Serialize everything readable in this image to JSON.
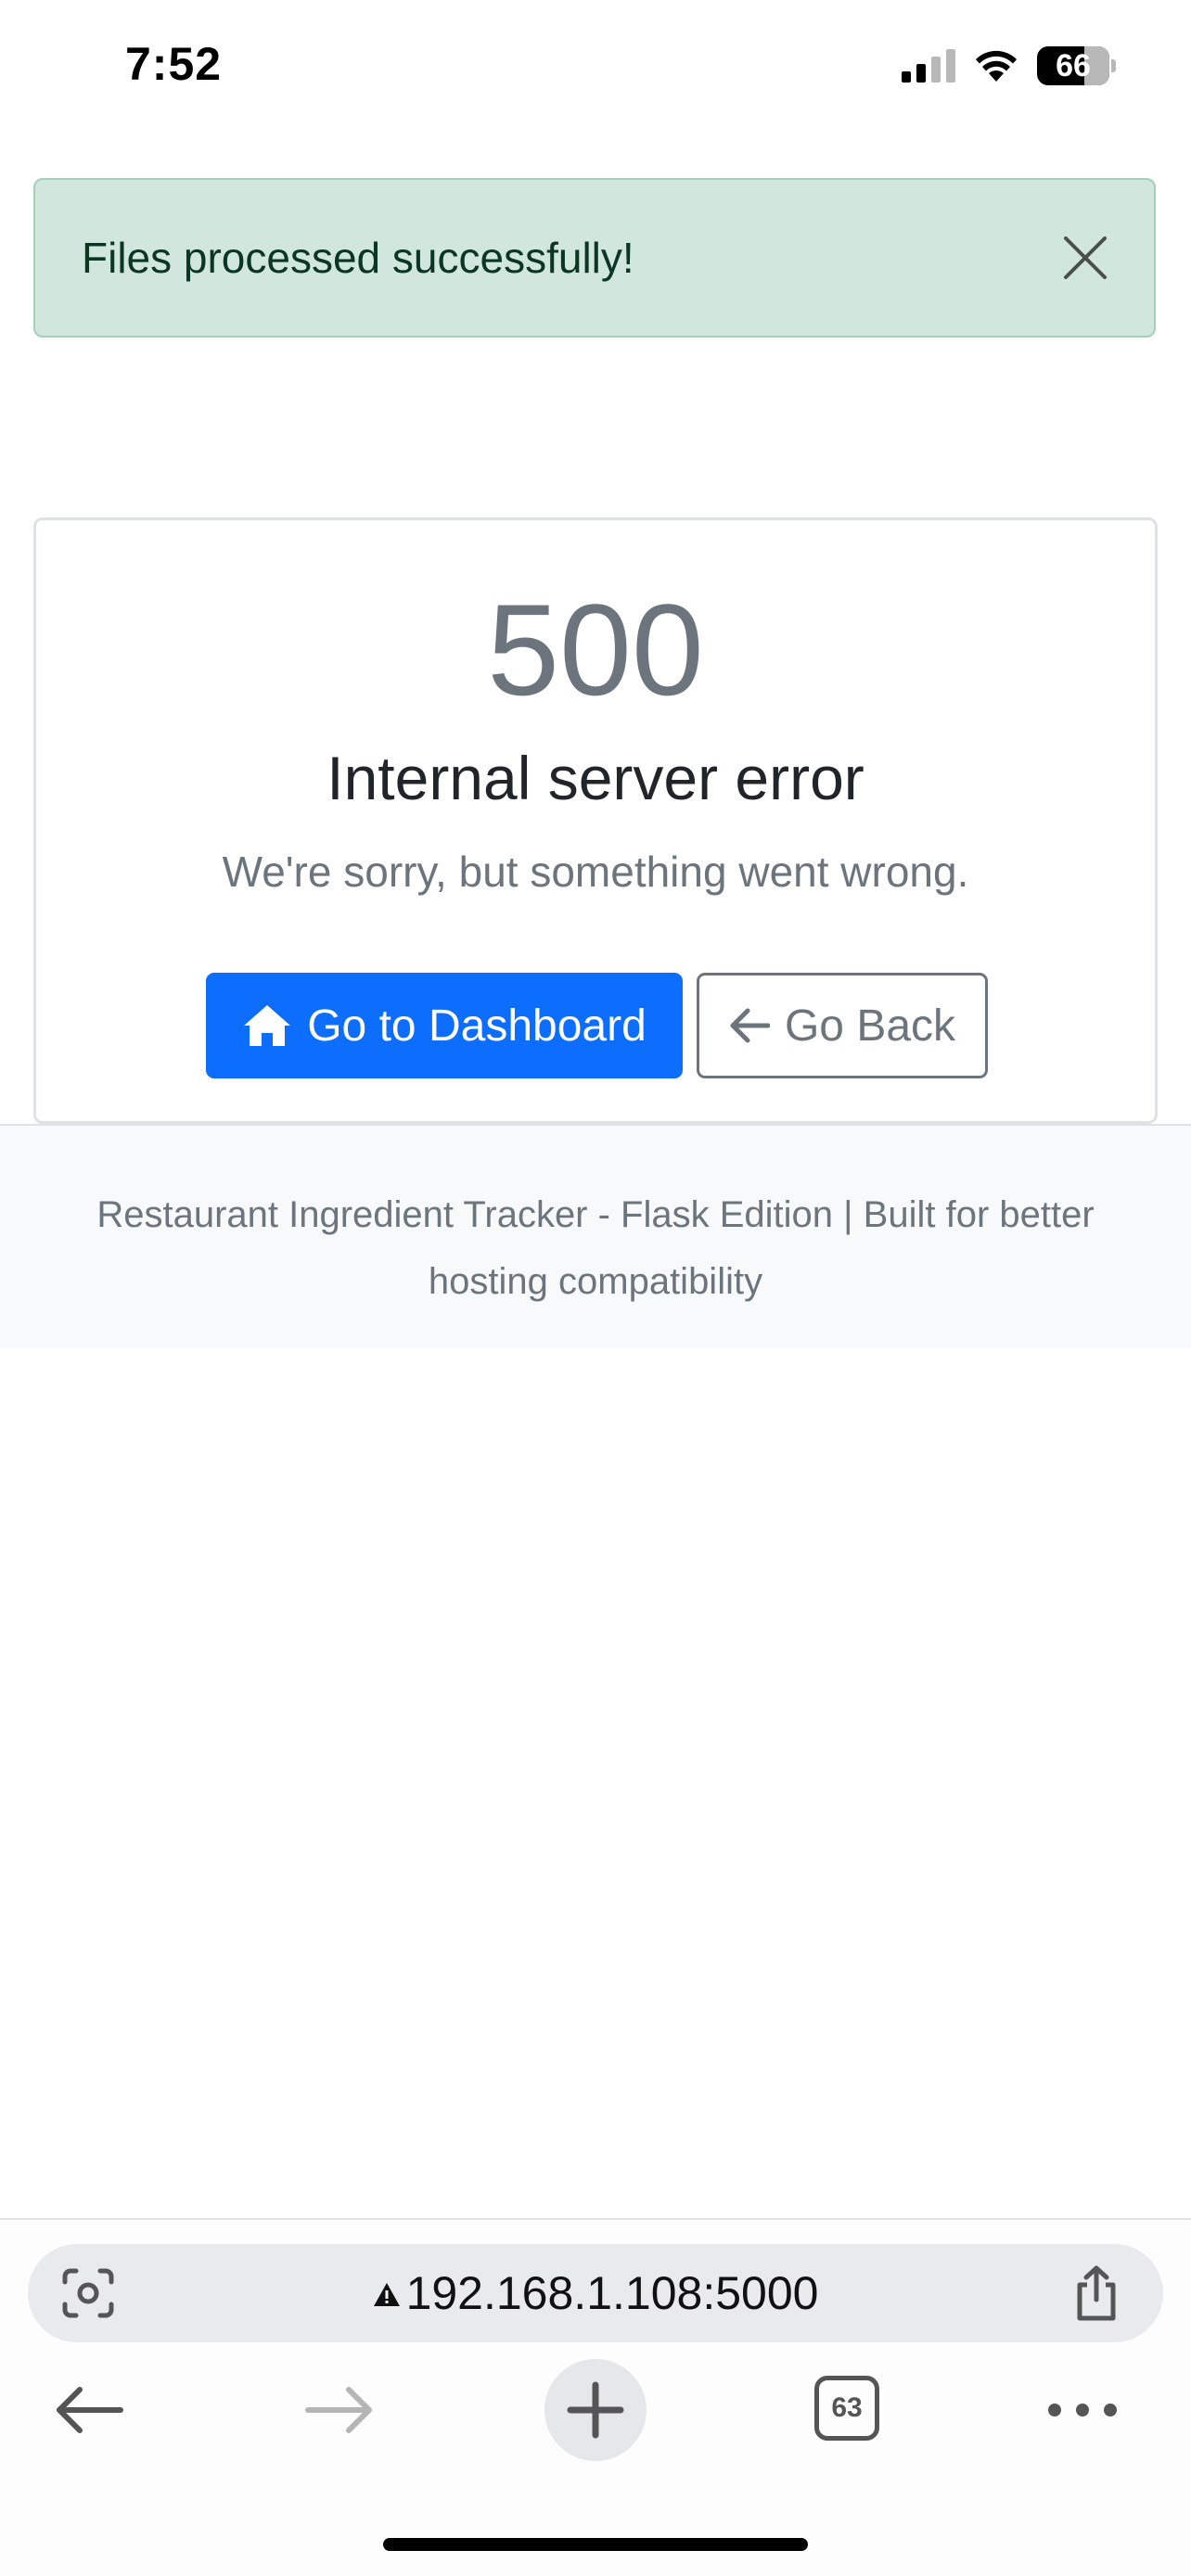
{
  "status_bar": {
    "time": "7:52",
    "battery_level": "66",
    "battery_fraction": 0.66
  },
  "alert": {
    "message": "Files processed successfully!",
    "close_icon": "close-icon",
    "colors": {
      "background": "#d1e7dd",
      "border": "#a3cfbb",
      "text": "#0a3622"
    }
  },
  "error_card": {
    "code": "500",
    "title": "Internal server error",
    "message": "We're sorry, but something went wrong.",
    "primary_button": {
      "label": "Go to Dashboard",
      "icon": "home-icon",
      "color": "#0d6efd"
    },
    "secondary_button": {
      "label": "Go Back",
      "icon": "arrow-left-icon",
      "color": "#6c757d"
    }
  },
  "footer": {
    "text": "Restaurant Ingredient Tracker - Flask Edition | Built for better hosting compatibility"
  },
  "browser": {
    "url": "192.168.1.108:5000",
    "security_icon": "warning-icon",
    "tab_count": "63",
    "icons": [
      "lens-icon",
      "share-icon",
      "back-arrow-icon",
      "forward-arrow-icon",
      "plus-icon",
      "tabs-icon",
      "more-icon"
    ]
  }
}
